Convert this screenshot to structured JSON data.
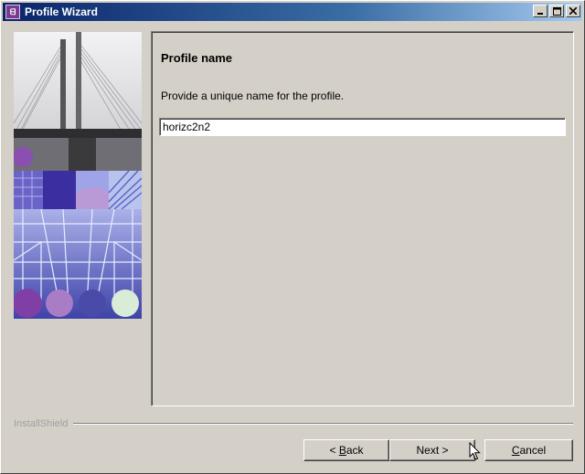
{
  "window": {
    "title": "Profile Wizard",
    "controls": [
      "minimize",
      "maximize",
      "close"
    ]
  },
  "page": {
    "heading": "Profile name",
    "description": "Provide a unique name for the profile.",
    "name_field": {
      "value": "horizc2n2"
    }
  },
  "footer": {
    "brand": "InstallShield",
    "back": {
      "prefix": "< ",
      "mnemonic": "B",
      "rest": "ack"
    },
    "next": {
      "label": "Next >"
    },
    "cancel": {
      "mnemonic": "C",
      "rest": "ancel"
    }
  },
  "colors": {
    "titlebar_start": "#0a246a",
    "titlebar_end": "#a6caf0",
    "face": "#d4d0c8"
  },
  "icons": {
    "app": "installshield-app-icon",
    "pointer": "mouse-pointer-icon"
  }
}
